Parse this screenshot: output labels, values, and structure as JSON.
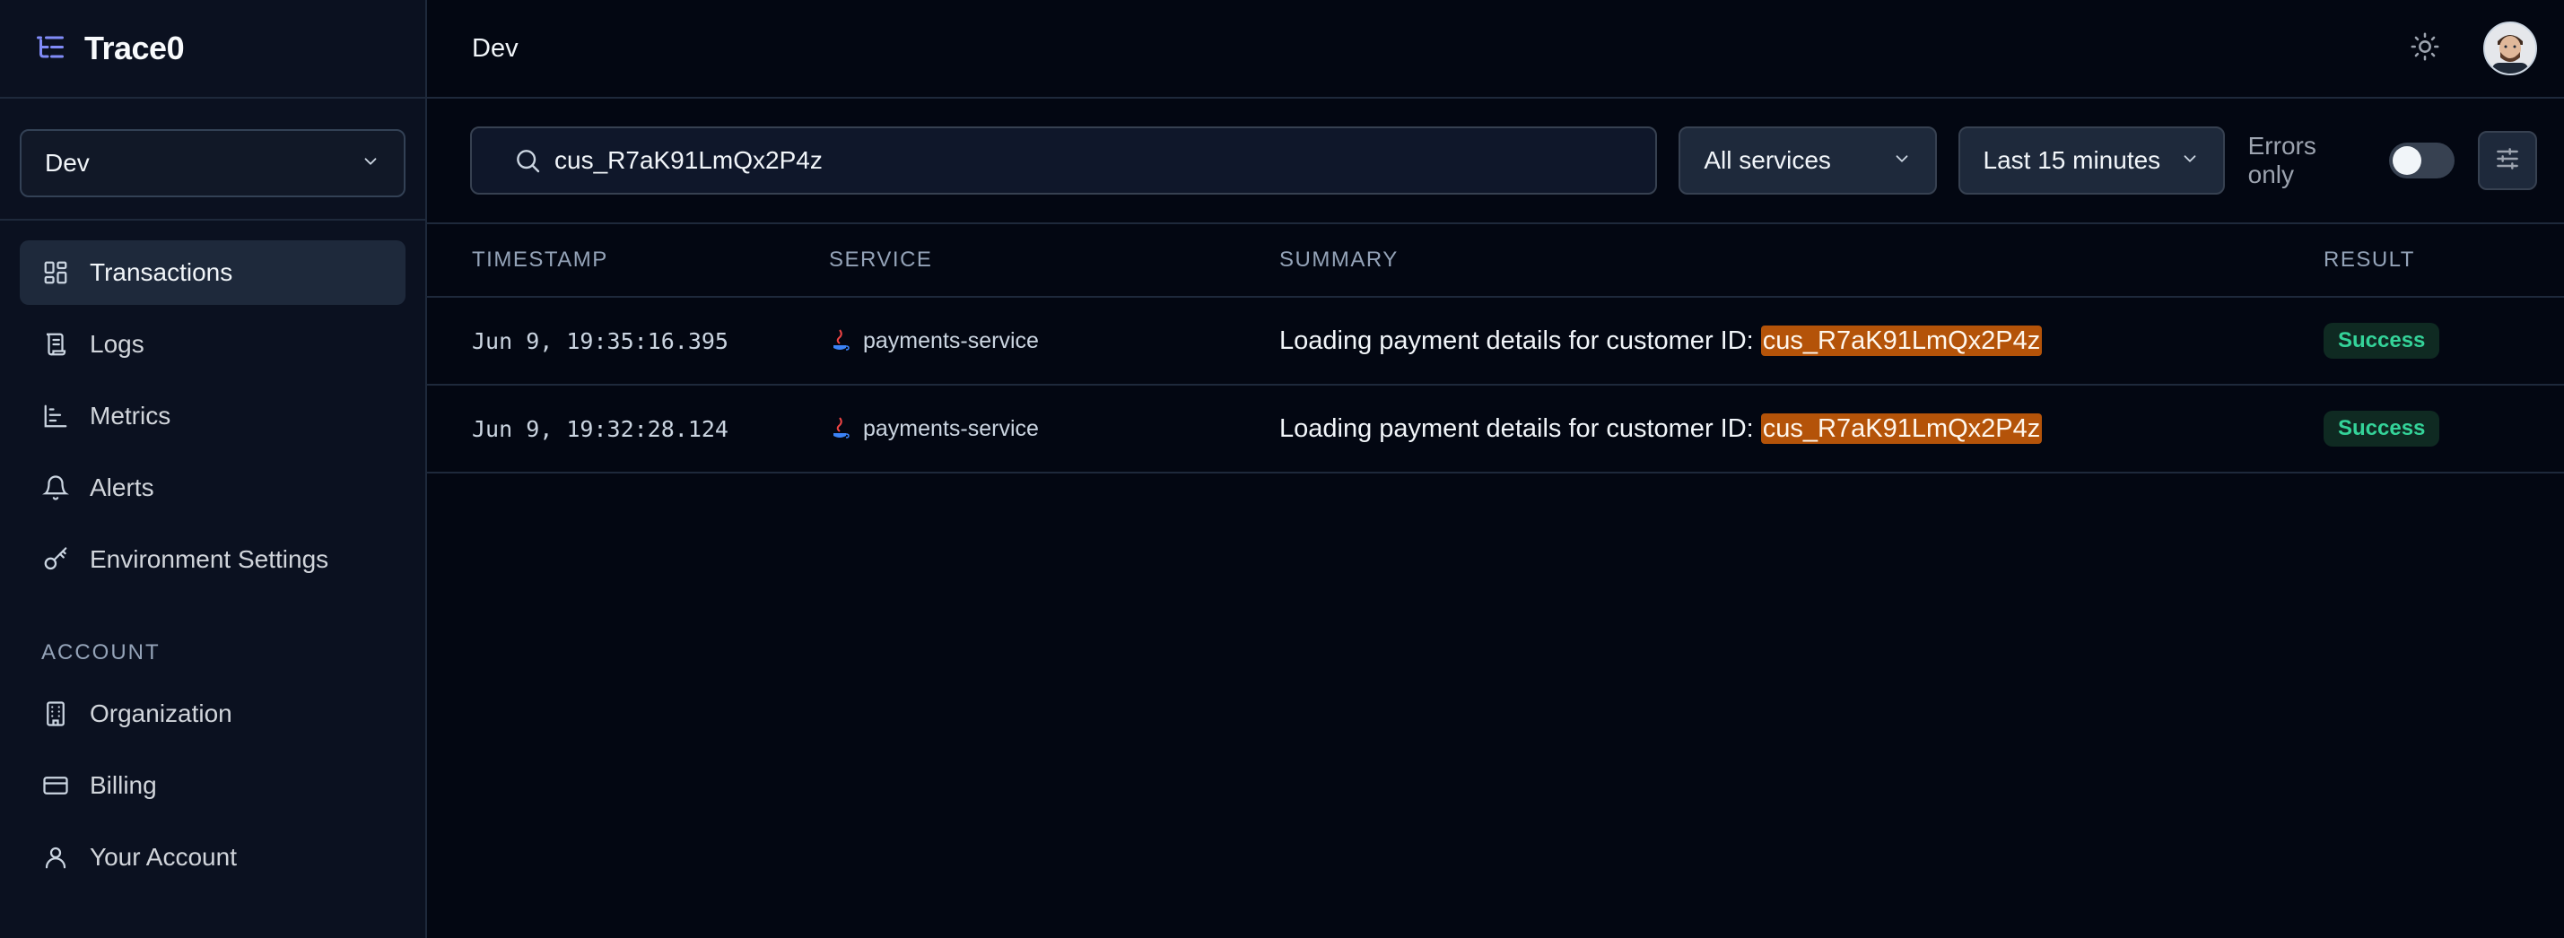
{
  "brand": {
    "name": "Trace0"
  },
  "environment": {
    "selected": "Dev"
  },
  "nav": {
    "items": [
      {
        "label": "Transactions"
      },
      {
        "label": "Logs"
      },
      {
        "label": "Metrics"
      },
      {
        "label": "Alerts"
      },
      {
        "label": "Environment Settings"
      }
    ],
    "account_label": "ACCOUNT",
    "account_items": [
      {
        "label": "Organization"
      },
      {
        "label": "Billing"
      },
      {
        "label": "Your Account"
      }
    ]
  },
  "header": {
    "title": "Dev"
  },
  "filters": {
    "search_value": "cus_R7aK91LmQx2P4z",
    "services": "All services",
    "time_range": "Last 15 minutes",
    "errors_only_label": "Errors only",
    "errors_only": false
  },
  "table": {
    "columns": [
      "TIMESTAMP",
      "SERVICE",
      "SUMMARY",
      "RESULT"
    ],
    "rows": [
      {
        "timestamp": "Jun 9, 19:35:16.395",
        "service": "payments-service",
        "summary_prefix": "Loading payment details for customer ID: ",
        "summary_highlight": "cus_R7aK91LmQx2P4z",
        "result": "Success"
      },
      {
        "timestamp": "Jun 9, 19:32:28.124",
        "service": "payments-service",
        "summary_prefix": "Loading payment details for customer ID: ",
        "summary_highlight": "cus_R7aK91LmQx2P4z",
        "result": "Success"
      }
    ]
  },
  "colors": {
    "accent": "#6366f1",
    "highlight": "#b45309",
    "success": "#34d399",
    "background": "#030712",
    "sidebar": "#0b1120"
  },
  "icons": {
    "logo": "list-tree-icon",
    "theme": "sun-icon",
    "search": "search-icon",
    "settings": "sliders-icon"
  }
}
